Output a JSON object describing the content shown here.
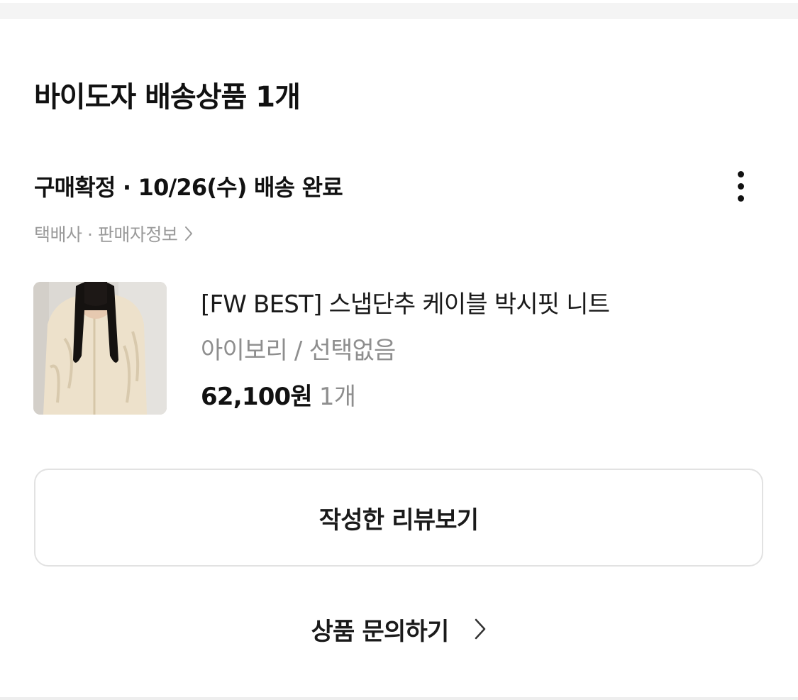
{
  "section": {
    "title": "바이도자 배송상품 1개"
  },
  "order": {
    "status": "구매확정 · 10/26(수) 배송 완료",
    "more_icon": "more-vertical-icon",
    "seller_link": "택배사 · 판매자정보",
    "seller_link_icon": "chevron-right-icon"
  },
  "product": {
    "image_alt": "상품 이미지",
    "name": "[FW BEST] 스냅단추 케이블 박시핏 니트",
    "option": "아이보리 / 선택없음",
    "price": "62,100원",
    "quantity": "1개"
  },
  "actions": {
    "review_label": "작성한 리뷰보기",
    "inquiry_label": "상품 문의하기",
    "inquiry_icon": "chevron-right-icon"
  },
  "colors": {
    "text_primary": "#111111",
    "text_secondary": "#8e8e8e",
    "border": "#e2e2e2",
    "background_strip": "#f4f4f4"
  }
}
